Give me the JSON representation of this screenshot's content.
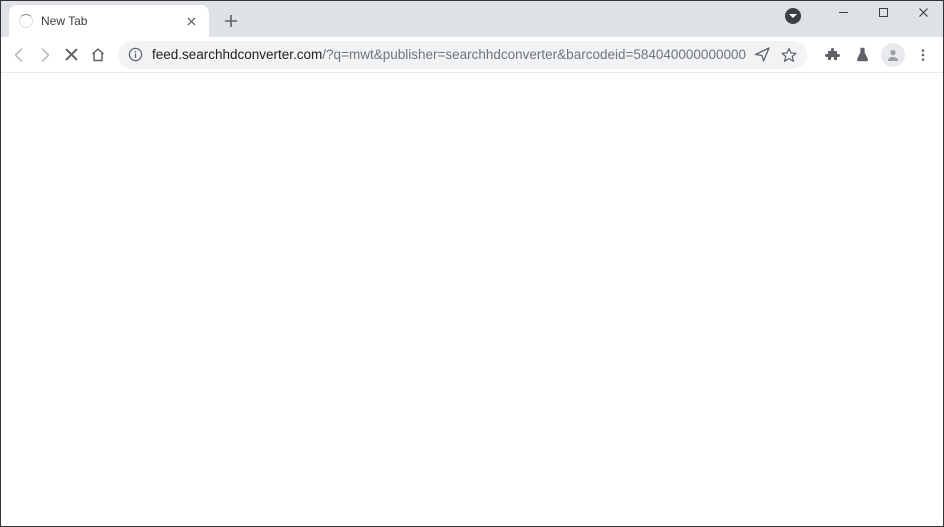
{
  "tab": {
    "title": "New Tab"
  },
  "url": {
    "host": "feed.searchhdconverter.com",
    "path": "/?q=mwt&publisher=searchhdconverter&barcodeid=584040000000000"
  }
}
